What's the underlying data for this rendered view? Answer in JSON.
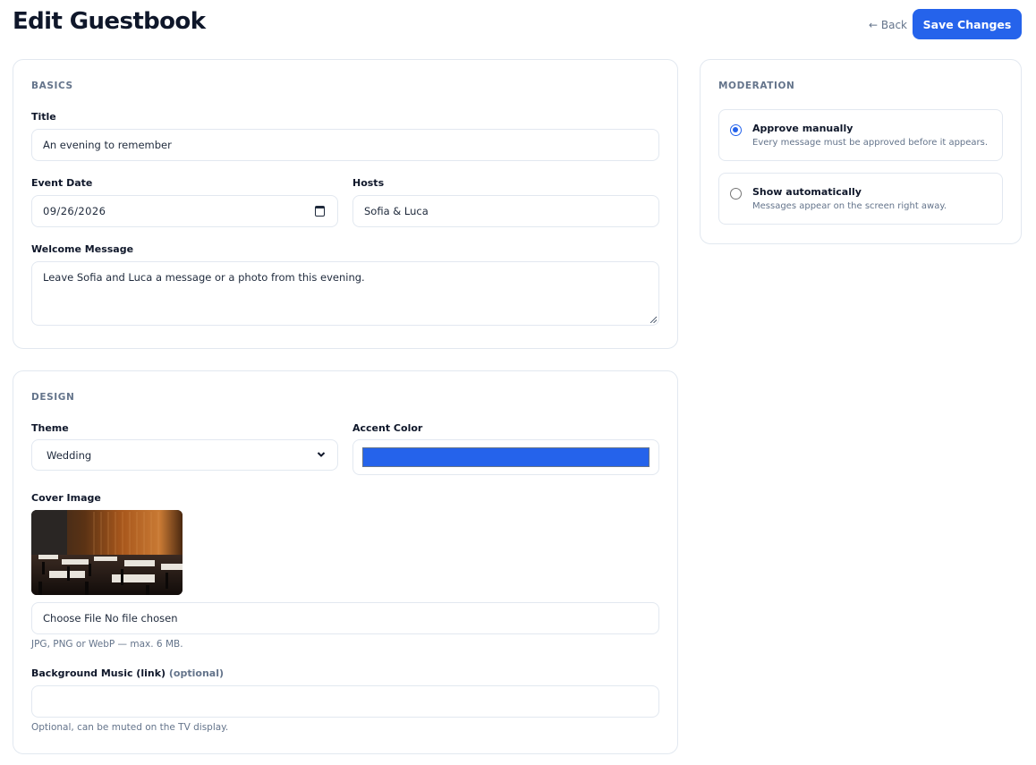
{
  "header": {
    "title": "Edit Guestbook",
    "back_label": "← Back",
    "save_label": "Save Changes"
  },
  "basics": {
    "section_label": "BASICS",
    "title_label": "Title",
    "title_value": "An evening to remember",
    "event_date_label": "Event Date",
    "event_date_value": "09/26/2026",
    "hosts_label": "Hosts",
    "hosts_value": "Sofia & Luca",
    "welcome_label": "Welcome Message",
    "welcome_value": "Leave Sofia and Luca a message or a photo from this evening."
  },
  "design": {
    "section_label": "DESIGN",
    "theme_label": "Theme",
    "theme_value": "Wedding",
    "accent_label": "Accent Color",
    "accent_color": "#2563eb",
    "cover_label": "Cover Image",
    "file_button_label": "Choose File",
    "file_status": "No file chosen",
    "cover_hint": "JPG, PNG or WebP — max. 6 MB.",
    "music_label": "Background Music (link)",
    "music_optional": "(optional)",
    "music_value": "",
    "music_hint": "Optional, can be muted on the TV display."
  },
  "moderation": {
    "section_label": "MODERATION",
    "options": [
      {
        "title": "Approve manually",
        "description": "Every message must be approved before it appears.",
        "selected": true
      },
      {
        "title": "Show automatically",
        "description": "Messages appear on the screen right away.",
        "selected": false
      }
    ]
  },
  "icons": {
    "calendar": "calendar-icon",
    "select": "chevron-down-icon",
    "back": "arrow-left-icon"
  },
  "colors": {
    "primary": "#2563eb",
    "border": "#e2e8f0",
    "muted_text": "#64748b"
  }
}
